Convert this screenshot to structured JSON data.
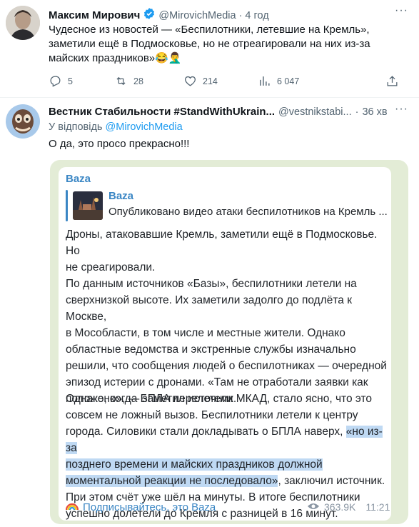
{
  "tweet1": {
    "author_name": "Максим Мирович",
    "handle": "@MirovichMedia",
    "time": "4 год",
    "text_line1": "Чудесное из новостей — «Беспилотники, летевшие на Кремль»,",
    "text_line2": "заметили ещё в Подмосковье, но не отреагировали на них из-за",
    "text_line3": "майских праздников»😂🤦‍♂️",
    "replies": "5",
    "retweets": "28",
    "likes": "214",
    "views": "6 047"
  },
  "tweet2": {
    "author_name": "Вестник Стабильности #StandWithUkrain...",
    "handle": "@vestnikstabi...",
    "time": "36 хв",
    "reply_prefix": "У відповідь",
    "reply_to": "@MirovichMedia",
    "text": "О да, это просо прекрасно!!!"
  },
  "telegram": {
    "channel": "Baza",
    "quote_channel": "Baza",
    "quote_text": "Опубликовано видео атаки беспилотников на Кремль ...",
    "p1": [
      "Дроны, атаковавшие Кремль, заметили ещё в Подмосковье. Но",
      "не среагировали."
    ],
    "p2": [
      "По данным источников «Базы», беспилотники летели на",
      "сверхнизкой высоте. Их заметили задолго до подлёта к Москве,",
      "в Мособласти, в том числе и местные жители. Однако",
      "областные ведомства и экстренные службы изначально",
      "решили, что сообщения людей о беспилотниках — очередной",
      "эпизод истерии с дронами. «Там не отработали заявки как",
      "положено», — заметил источник."
    ],
    "p3_l1": "Однако, когда БПЛА перелетели МКАД, стало ясно, что это",
    "p3_l2": "совсем не ложный вызов. Беспилотники летели к центру",
    "p3_l3_plain": "города. Силовики стали докладывать о БПЛА наверх, ",
    "p3_l3_hl": "«но из-за",
    "p3_l4_hl": "позднего времени и майских праздников должной",
    "p3_l5_hl": "моментальной реакции не последовало»",
    "p3_l5_plain": ", заключил источник.",
    "p3_l6": "При этом счёт уже шёл на минуты. В итоге беспилотники",
    "p3_l7": "успешно долетели до Кремля с разницей в 16 минут.",
    "footer_link": "Подписывайтесь, это Baza",
    "views": "363.9K",
    "time": "11:21"
  },
  "colors": {
    "verified": "#1d9bf0",
    "link": "#1d9bf0",
    "tg_link": "#3a86c4",
    "highlight": "#bfd9f3"
  }
}
